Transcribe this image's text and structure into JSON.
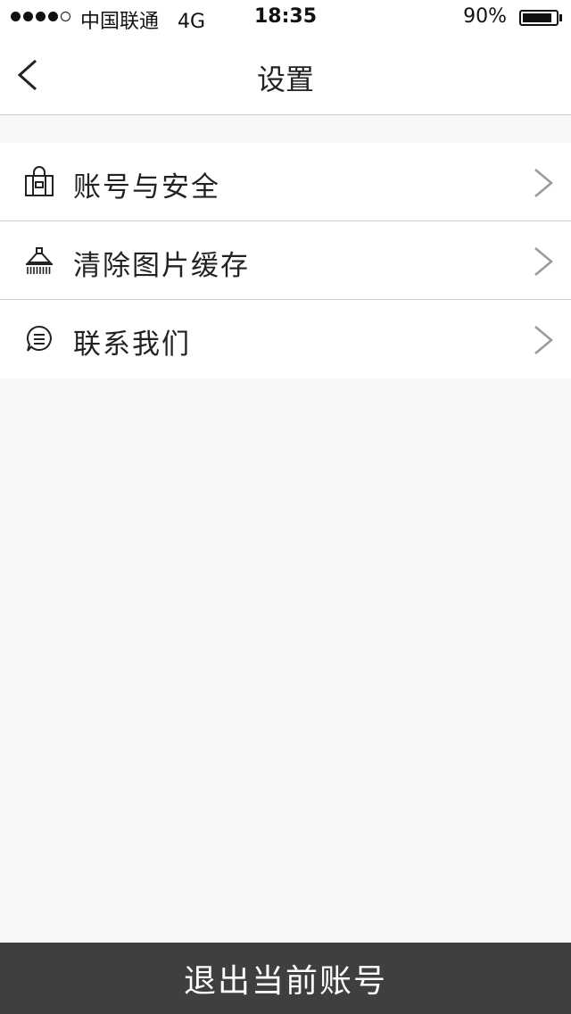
{
  "status_bar": {
    "carrier": "中国联通",
    "network": "4G",
    "time": "18:35",
    "battery_percent": "90%",
    "battery_level": 0.9,
    "signal_filled": 4,
    "signal_total": 5
  },
  "nav": {
    "title": "设置",
    "back_icon": "chevron-left-icon"
  },
  "settings_items": [
    {
      "label": "账号与安全",
      "icon": "lock-briefcase-icon"
    },
    {
      "label": "清除图片缓存",
      "icon": "broom-icon"
    },
    {
      "label": "联系我们",
      "icon": "chat-bubble-icon"
    }
  ],
  "logout": {
    "label": "退出当前账号"
  },
  "colors": {
    "background": "#f8f8f8",
    "surface": "#ffffff",
    "divider": "#cfcfcf",
    "logout_bg": "#3f3f3f",
    "chevron": "#999999"
  }
}
